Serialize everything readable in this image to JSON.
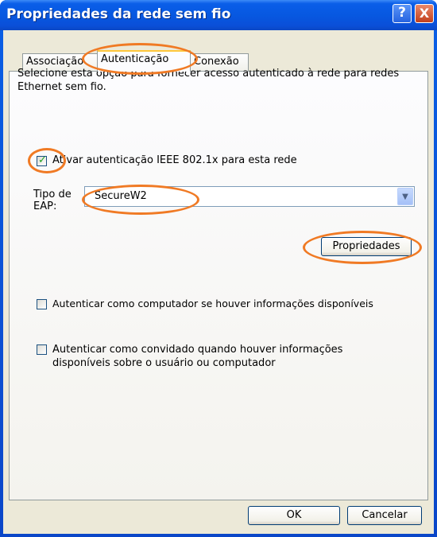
{
  "window": {
    "title": "Propriedades da rede sem fio"
  },
  "titlebar": {
    "help_glyph": "?",
    "close_glyph": "X"
  },
  "tabs": [
    {
      "label": "Associação",
      "active": false
    },
    {
      "label": "Autenticação",
      "active": true
    },
    {
      "label": "Conexão",
      "active": false
    }
  ],
  "auth": {
    "description": "Selecione esta opção para fornecer acesso autenticado à rede para redes Ethernet sem fio.",
    "enable_8021x": {
      "label": "Ativar autenticação IEEE 802.1x para esta rede",
      "checked": true
    },
    "eap_type": {
      "label": "Tipo de EAP:",
      "value": "SecureW2"
    },
    "properties_button": "Propriedades",
    "auth_as_computer": {
      "label": "Autenticar como computador se houver informações disponíveis",
      "checked": false
    },
    "auth_as_guest": {
      "label": "Autenticar como convidado quando houver informações disponíveis sobre o usuário ou computador",
      "checked": false
    }
  },
  "footer": {
    "ok_label": "OK",
    "cancel_label": "Cancelar"
  },
  "colors": {
    "highlight": "#f07a24",
    "titlebar": "#0a5ee8",
    "dialog_bg": "#ece9d8"
  }
}
